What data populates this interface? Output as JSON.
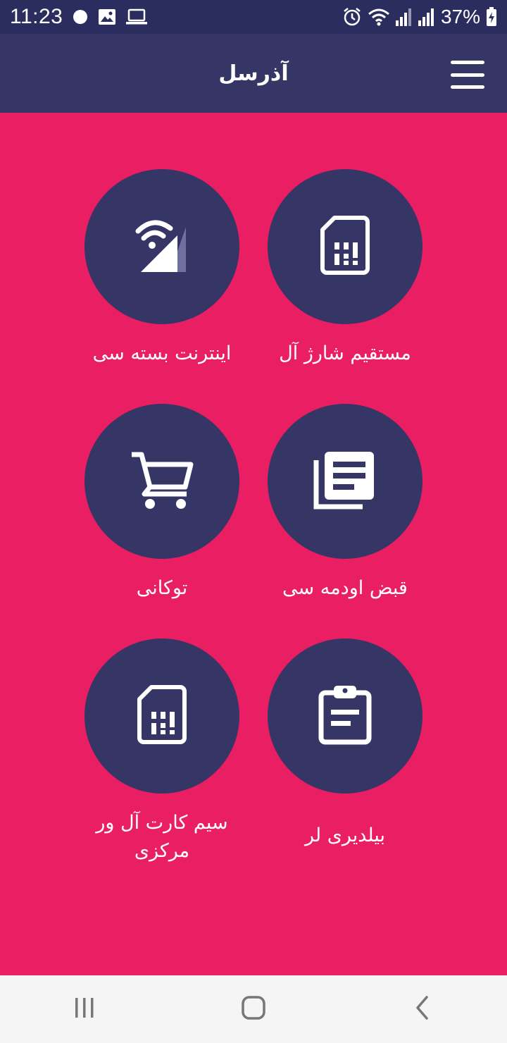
{
  "status_bar": {
    "time": "11:23",
    "battery": "37%",
    "icons_left": [
      "notification-dot-icon",
      "image-icon",
      "laptop-icon"
    ],
    "icons_right": [
      "alarm-icon",
      "wifi-icon",
      "signal-icon",
      "signal-icon",
      "battery-charging-icon"
    ]
  },
  "app_bar": {
    "title": "آذرسل",
    "menu_icon": "hamburger-menu-icon"
  },
  "tiles": [
    {
      "label": "مستقیم شارژ آل",
      "icon": "sim-card-icon"
    },
    {
      "label": "اینترنت بسته سی",
      "icon": "wifi-signal-icon"
    },
    {
      "label": "قبض اودمه سی",
      "icon": "newspaper-icon"
    },
    {
      "label": "توکانی",
      "icon": "shopping-cart-icon"
    },
    {
      "label": "بیلدیری لر",
      "icon": "clipboard-icon"
    },
    {
      "label": "سیم کارت آل ور مرکزی",
      "icon": "sim-card-icon"
    }
  ],
  "nav_bar": {
    "items": [
      "recent-apps-icon",
      "home-icon",
      "back-icon"
    ]
  },
  "colors": {
    "background": "#e91e63",
    "app_bar": "#353566",
    "status_bar": "#2a2d5e",
    "circle": "#353566",
    "nav_bar": "#f5f5f5"
  }
}
